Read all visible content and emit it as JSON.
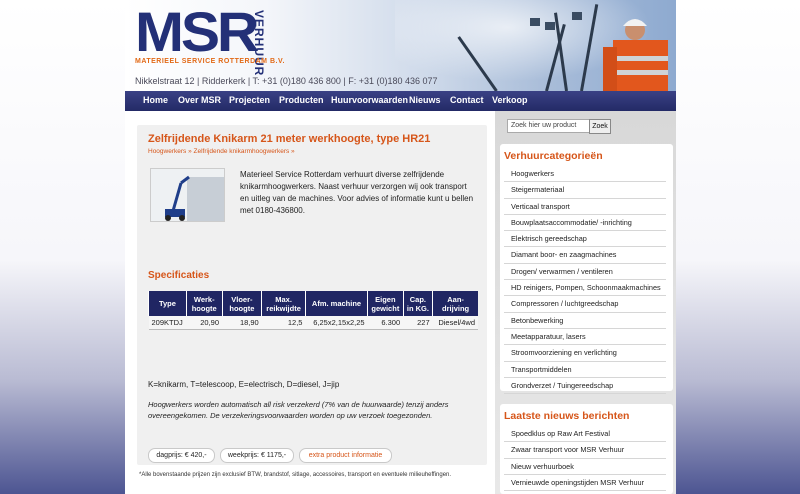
{
  "header": {
    "logo_main": "MSR",
    "logo_side": "VERHUUR",
    "logo_sub": "MATERIEEL SERVICE ROTTERDAM B.V.",
    "address": "Nikkelstraat 12 | Ridderkerk | T: +31 (0)180 436 800 | F: +31 (0)180 436 077"
  },
  "nav": [
    "Home",
    "Over MSR",
    "Projecten",
    "Producten",
    "Huurvoorwaarden",
    "Nieuws",
    "Contact",
    "Verkoop"
  ],
  "product": {
    "title": "Zelfrijdende Knikarm 21 meter werkhoogte, type HR21",
    "breadcrumb": "Hoogwerkers » Zelfrijdende knikarmhoogwerkers »",
    "description": "Materieel Service Rotterdam verhuurt diverse zelfrijdende knikarmhoogwerkers. Naast verhuur verzorgen wij ook transport en uitleg van de machines. Voor advies of informatie kunt u bellen met 0180-436800.",
    "specs_heading": "Specificaties",
    "table_headers": [
      "Type",
      "Werk-hoogte",
      "Vloer-hoogte",
      "Max. reikwijdte",
      "Afm. machine",
      "Eigen gewicht",
      "Cap. in KG.",
      "Aan-drijving"
    ],
    "table_row": [
      "209KTDJ",
      "20,90",
      "18,90",
      "12,5",
      "6,25x2,15x2,25",
      "6.300",
      "227",
      "Diesel/4wd"
    ],
    "legend": "K=knikarm, T=telescoop, E=electrisch, D=diesel, J=jip",
    "note": "Hoogwerkers worden automatisch all risk verzekerd (7% van de huurwaarde) tenzij anders overeengekomen. De verzekeringsvoorwaarden worden op uw verzoek toegezonden.",
    "buttons": [
      "dagprijs: € 420,-",
      "weekprijs: € 1175,-",
      "extra product informatie"
    ],
    "footnote": "*Alle bovenstaande prijzen zijn exclusief BTW, brandstof, sitlage, accessoires, transport en eventuele milieuheffingen."
  },
  "sidebar": {
    "search_placeholder": "Zoek hier uw product",
    "search_button": "Zoek",
    "categories_title": "Verhuurcategorieën",
    "categories": [
      "Hoogwerkers",
      "Steigermateriaal",
      "Verticaal transport",
      "Bouwplaatsaccommodatie/ -inrichting",
      "Elektrisch gereedschap",
      "Diamant boor- en zaagmachines",
      "Drogen/ verwarmen / ventileren",
      "HD reinigers, Pompen, Schoonmaakmachines",
      "Compressoren / luchtgreedschap",
      "Betonbewerking",
      "Meetapparatuur, lasers",
      "Stroomvoorziening en verlichting",
      "Transportmiddelen",
      "Grondverzet / Tuingereedschap"
    ],
    "news_title": "Laatste nieuws berichten",
    "news": [
      "Spoedklus op Raw Art Festival",
      "Zwaar transport voor MSR Verhuur",
      "Nieuw verhuurboek",
      "Vernieuwde openingstijden MSR Verhuur"
    ]
  },
  "colors": {
    "navy": "#232a66",
    "orange": "#d6561a"
  }
}
